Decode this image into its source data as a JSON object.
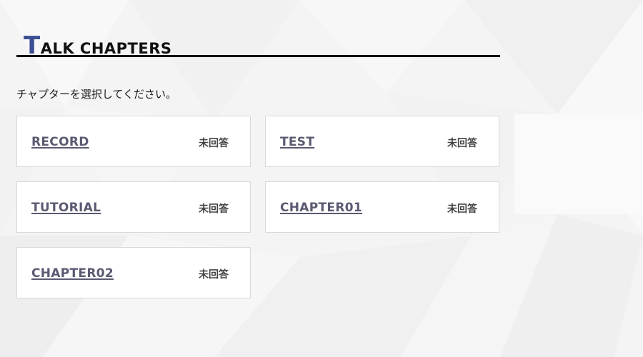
{
  "heading": {
    "first_letter": "T",
    "rest": "ALK CHAPTERS"
  },
  "instruction": "チャプターを選択してください。",
  "chapters": [
    {
      "name": "RECORD",
      "status": "未回答"
    },
    {
      "name": "TEST",
      "status": "未回答"
    },
    {
      "name": "TUTORIAL",
      "status": "未回答"
    },
    {
      "name": "CHAPTER01",
      "status": "未回答"
    },
    {
      "name": "CHAPTER02",
      "status": "未回答"
    }
  ],
  "colors": {
    "accent": "#3d4f94",
    "chapter_text": "#5a5a72",
    "card_border": "#d9d9d9",
    "background": "#f3f3f3"
  }
}
